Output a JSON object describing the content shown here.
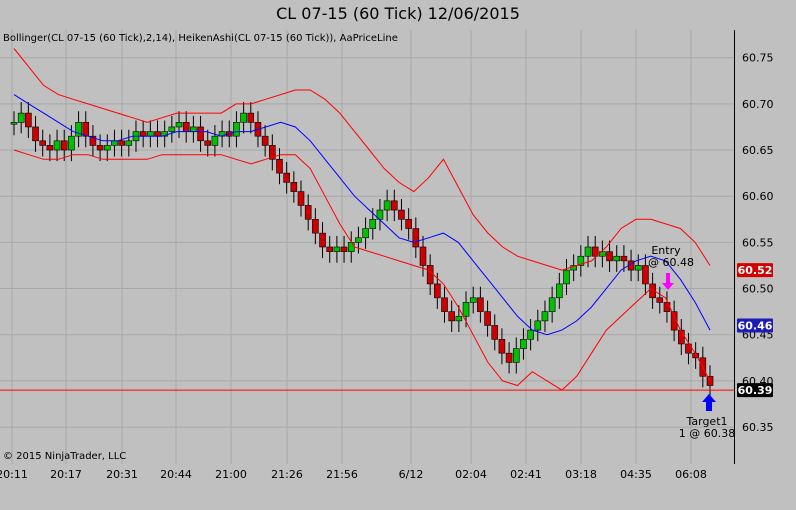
{
  "title": "CL 07-15 (60 Tick)  12/06/2015",
  "indicator_label": "Bollinger(CL 07-15 (60 Tick),2,14), HeikenAshi(CL 07-15 (60 Tick)), AaPriceLine",
  "copyright": "© 2015 NinjaTrader, LLC",
  "annotations": {
    "entry_line1": "Entry",
    "entry_line2": "@ 60.48",
    "target_line1": "Target1",
    "target_line2": "1 @ 60.38"
  },
  "price_tags": [
    {
      "value": "60.52",
      "color": "#d40000"
    },
    {
      "value": "60.46",
      "color": "#1c1cb4"
    },
    {
      "value": "60.39",
      "color": "#000000"
    }
  ],
  "colors": {
    "background": "#c0c0c0",
    "bullish": "#00c000",
    "bearish": "#cc0000",
    "bollinger_band": "#ff0000",
    "bollinger_mid": "#0000ff",
    "price_line": "#ff0000",
    "grid": "#a8a8a8",
    "entry_arrow": "#ff00ff",
    "target_arrow": "#0000ff"
  },
  "chart_data": {
    "type": "candlestick",
    "y_ticks": [
      "60.75",
      "60.70",
      "60.65",
      "60.60",
      "60.55",
      "60.50",
      "60.45",
      "60.40",
      "60.35"
    ],
    "x_ticks": [
      "20:11",
      "20:17",
      "20:31",
      "20:44",
      "21:00",
      "21:26",
      "21:56",
      "6/12",
      "02:04",
      "02:41",
      "03:18",
      "04:35",
      "06:08"
    ],
    "ylim": [
      60.31,
      60.78
    ],
    "price_line": 60.39,
    "grid": true,
    "candles": [
      [
        60.678,
        60.68
      ],
      [
        60.68,
        60.69
      ],
      [
        60.69,
        60.675
      ],
      [
        60.675,
        60.66
      ],
      [
        60.66,
        60.655
      ],
      [
        60.655,
        60.65
      ],
      [
        60.65,
        60.66
      ],
      [
        60.66,
        60.65
      ],
      [
        60.65,
        60.665
      ],
      [
        60.665,
        60.68
      ],
      [
        60.68,
        60.665
      ],
      [
        60.665,
        60.655
      ],
      [
        60.655,
        60.65
      ],
      [
        60.65,
        60.655
      ],
      [
        60.655,
        60.66
      ],
      [
        60.66,
        60.655
      ],
      [
        60.655,
        60.66
      ],
      [
        60.66,
        60.67
      ],
      [
        60.67,
        60.665
      ],
      [
        60.665,
        60.67
      ],
      [
        60.67,
        60.665
      ],
      [
        60.665,
        60.67
      ],
      [
        60.67,
        60.675
      ],
      [
        60.675,
        60.68
      ],
      [
        60.68,
        60.67
      ],
      [
        60.67,
        60.675
      ],
      [
        60.675,
        60.66
      ],
      [
        60.66,
        60.655
      ],
      [
        60.655,
        60.665
      ],
      [
        60.665,
        60.67
      ],
      [
        60.67,
        60.665
      ],
      [
        60.665,
        60.68
      ],
      [
        60.68,
        60.69
      ],
      [
        60.69,
        60.68
      ],
      [
        60.68,
        60.665
      ],
      [
        60.665,
        60.655
      ],
      [
        60.655,
        60.64
      ],
      [
        60.64,
        60.625
      ],
      [
        60.625,
        60.615
      ],
      [
        60.615,
        60.605
      ],
      [
        60.605,
        60.59
      ],
      [
        60.59,
        60.575
      ],
      [
        60.575,
        60.56
      ],
      [
        60.56,
        60.545
      ],
      [
        60.545,
        60.54
      ],
      [
        60.54,
        60.545
      ],
      [
        60.545,
        60.54
      ],
      [
        60.54,
        60.55
      ],
      [
        60.55,
        60.555
      ],
      [
        60.555,
        60.565
      ],
      [
        60.565,
        60.575
      ],
      [
        60.575,
        60.585
      ],
      [
        60.585,
        60.595
      ],
      [
        60.595,
        60.585
      ],
      [
        60.585,
        60.575
      ],
      [
        60.575,
        60.565
      ],
      [
        60.565,
        60.545
      ],
      [
        60.545,
        60.525
      ],
      [
        60.525,
        60.505
      ],
      [
        60.505,
        60.49
      ],
      [
        60.49,
        60.475
      ],
      [
        60.475,
        60.465
      ],
      [
        60.465,
        60.47
      ],
      [
        60.47,
        60.485
      ],
      [
        60.485,
        60.49
      ],
      [
        60.49,
        60.475
      ],
      [
        60.475,
        60.46
      ],
      [
        60.46,
        60.445
      ],
      [
        60.445,
        60.43
      ],
      [
        60.43,
        60.42
      ],
      [
        60.42,
        60.435
      ],
      [
        60.435,
        60.445
      ],
      [
        60.445,
        60.455
      ],
      [
        60.455,
        60.465
      ],
      [
        60.465,
        60.475
      ],
      [
        60.475,
        60.49
      ],
      [
        60.49,
        60.505
      ],
      [
        60.505,
        60.52
      ],
      [
        60.52,
        60.525
      ],
      [
        60.525,
        60.535
      ],
      [
        60.535,
        60.545
      ],
      [
        60.545,
        60.535
      ],
      [
        60.535,
        60.54
      ],
      [
        60.54,
        60.53
      ],
      [
        60.53,
        60.535
      ],
      [
        60.535,
        60.53
      ],
      [
        60.53,
        60.52
      ],
      [
        60.52,
        60.525
      ],
      [
        60.525,
        60.505
      ],
      [
        60.505,
        60.49
      ],
      [
        60.49,
        60.485
      ],
      [
        60.485,
        60.475
      ],
      [
        60.475,
        60.455
      ],
      [
        60.455,
        60.44
      ],
      [
        60.44,
        60.43
      ],
      [
        60.43,
        60.425
      ],
      [
        60.425,
        60.405
      ],
      [
        60.405,
        60.395
      ]
    ],
    "bb_upper": [
      60.76,
      60.74,
      60.72,
      60.71,
      60.705,
      60.7,
      60.695,
      60.69,
      60.685,
      60.68,
      60.685,
      60.69,
      60.69,
      60.69,
      60.69,
      60.7,
      60.7,
      60.705,
      60.71,
      60.715,
      60.715,
      60.705,
      60.69,
      60.67,
      60.65,
      60.63,
      60.615,
      60.605,
      60.62,
      60.64,
      60.61,
      60.58,
      60.56,
      60.545,
      60.535,
      60.53,
      60.525,
      60.52,
      60.525,
      60.53,
      60.545,
      60.565,
      60.575,
      60.575,
      60.57,
      60.565,
      60.55,
      60.525
    ],
    "bb_mid": [
      60.71,
      60.7,
      60.69,
      60.68,
      60.67,
      60.665,
      60.66,
      60.66,
      60.665,
      60.665,
      60.665,
      60.67,
      60.67,
      60.67,
      60.665,
      60.67,
      60.67,
      60.675,
      60.68,
      60.675,
      60.66,
      60.64,
      60.62,
      60.6,
      60.585,
      60.57,
      60.555,
      60.55,
      60.555,
      60.56,
      60.55,
      60.53,
      60.51,
      60.49,
      60.47,
      60.455,
      60.45,
      60.455,
      60.465,
      60.48,
      60.5,
      60.52,
      60.53,
      60.535,
      60.53,
      60.51,
      60.485,
      60.455
    ],
    "bb_lower": [
      60.65,
      60.645,
      60.64,
      60.64,
      60.645,
      60.645,
      60.64,
      60.64,
      60.64,
      60.64,
      60.645,
      60.645,
      60.645,
      60.645,
      60.645,
      60.64,
      60.635,
      60.64,
      60.645,
      60.645,
      60.63,
      60.6,
      60.57,
      60.545,
      60.54,
      60.535,
      60.53,
      60.525,
      60.52,
      60.505,
      60.48,
      60.45,
      60.42,
      60.4,
      60.395,
      60.41,
      60.4,
      60.39,
      60.405,
      60.43,
      60.455,
      60.47,
      60.485,
      60.5,
      60.49,
      60.455,
      60.43,
      60.4
    ]
  }
}
